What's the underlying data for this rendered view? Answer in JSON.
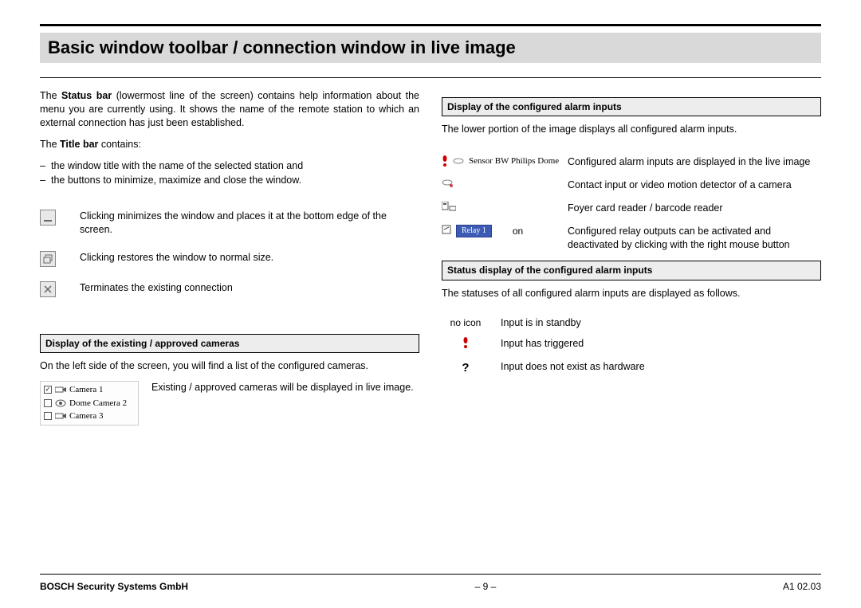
{
  "title": "Basic window toolbar / connection window in live image",
  "left": {
    "status_bar_para_pre": "The ",
    "status_bar_bold": "Status bar",
    "status_bar_para_post": " (lowermost line of the screen) contains help information about the menu you are currently using. It shows the name of the remote station to which an external connection has just been established.",
    "title_bar_pre": "The ",
    "title_bar_bold": "Title bar",
    "title_bar_post": " contains:",
    "title_bar_items": [
      "the window title with the name of the selected station and",
      "the buttons to minimize, maximize and close the window."
    ],
    "min_text": "Clicking minimizes the window and places it at the bottom edge of the screen.",
    "restore_text": "Clicking restores the window to normal size.",
    "close_text": "Terminates the existing connection",
    "cameras_heading": "Display of the existing / approved cameras",
    "cameras_para": "On the left side of the screen, you will find a list of the configured cameras.",
    "camera_list": [
      "Camera 1",
      "Dome Camera 2",
      "Camera 3"
    ],
    "camera_desc": "Existing / approved cameras will be displayed in live image."
  },
  "right": {
    "alarm_heading": "Display of the configured alarm inputs",
    "alarm_para": "The lower portion of the image displays all configured alarm inputs.",
    "sensor_label": "Sensor BW Philips Dome",
    "sensor_desc": "Configured alarm inputs are displayed in the live image",
    "contact_desc": "Contact input or video motion detector of a camera",
    "foyer_desc": "Foyer card reader / barcode reader",
    "relay_label": "Relay 1",
    "relay_state": "on",
    "relay_desc": "Configured relay outputs can be activated and deactivated by clicking with the right mouse button",
    "status_heading": "Status display of the configured alarm inputs",
    "status_para": "The statuses of all configured alarm inputs are displayed as follows.",
    "status_rows": [
      {
        "icon": "no icon",
        "text": "Input is in standby"
      },
      {
        "icon": "excl",
        "text": "Input has triggered"
      },
      {
        "icon": "?",
        "text": "Input does not exist as hardware"
      }
    ]
  },
  "footer": {
    "left": "BOSCH Security Systems GmbH",
    "center": "–  9  –",
    "right": "A1 02.03"
  }
}
